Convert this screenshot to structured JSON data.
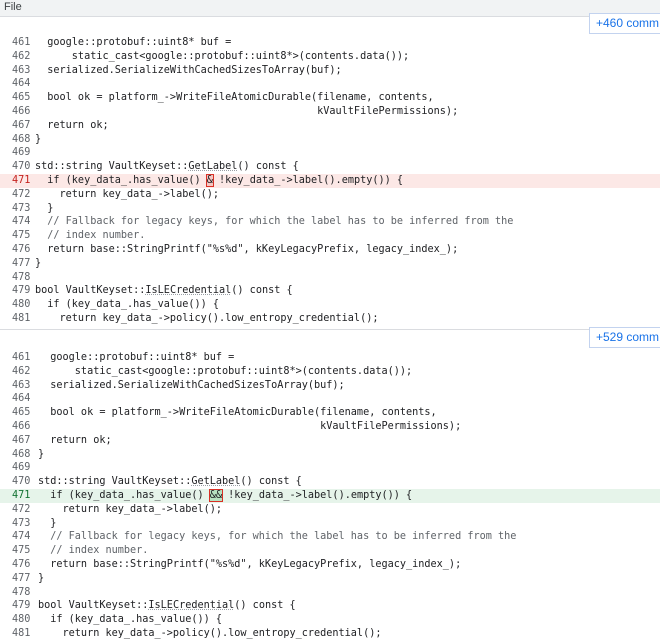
{
  "menu": {
    "file_label": "File"
  },
  "expanders": {
    "top": "+460 comm",
    "bottom": "+529 comm"
  },
  "colors": {
    "deleted_bg": "#fce8e6",
    "added_bg": "#e6f4ea",
    "highlight_border": "#d93025",
    "link": "#1a73e8"
  },
  "old_pane": {
    "lines": [
      {
        "num": "461",
        "text": "  google::protobuf::uint8* buf ="
      },
      {
        "num": "462",
        "text": "      static_cast<google::protobuf::uint8*>(contents.data());"
      },
      {
        "num": "463",
        "text": "  serialized.SerializeWithCachedSizesToArray(buf);"
      },
      {
        "num": "464",
        "text": ""
      },
      {
        "num": "465",
        "text": "  bool ok = platform_->WriteFileAtomicDurable(filename, contents,"
      },
      {
        "num": "466",
        "text": "                                              kVaultFilePermissions);"
      },
      {
        "num": "467",
        "text": "  return ok;"
      },
      {
        "num": "468",
        "text": "}"
      },
      {
        "num": "469",
        "text": ""
      },
      {
        "num": "470",
        "pre": "std::string VaultKeyset::",
        "fn": "GetLabel",
        "post": "() const {"
      },
      {
        "num": "471",
        "pre": "  if (key_data_.has_value() ",
        "mark": "&",
        "post": " !key_data_->label().empty()) {",
        "change": "del"
      },
      {
        "num": "472",
        "text": "    return key_data_->label();"
      },
      {
        "num": "473",
        "text": "  }"
      },
      {
        "num": "474",
        "text": "  // Fallback for legacy keys, for which the label has to be inferred from the",
        "comment": true
      },
      {
        "num": "475",
        "text": "  // index number.",
        "comment": true
      },
      {
        "num": "476",
        "text": "  return base::StringPrintf(\"%s%d\", kKeyLegacyPrefix, legacy_index_);"
      },
      {
        "num": "477",
        "text": "}"
      },
      {
        "num": "478",
        "text": ""
      },
      {
        "num": "479",
        "pre": "bool VaultKeyset::",
        "fn": "IsLECredential",
        "post": "() const {"
      },
      {
        "num": "480",
        "text": "  if (key_data_.has_value()) {"
      },
      {
        "num": "481",
        "text": "    return key_data_->policy().low_entropy_credential();"
      }
    ]
  },
  "new_pane": {
    "lines": [
      {
        "num": "461",
        "text": "  google::protobuf::uint8* buf ="
      },
      {
        "num": "462",
        "text": "      static_cast<google::protobuf::uint8*>(contents.data());"
      },
      {
        "num": "463",
        "text": "  serialized.SerializeWithCachedSizesToArray(buf);"
      },
      {
        "num": "464",
        "text": ""
      },
      {
        "num": "465",
        "text": "  bool ok = platform_->WriteFileAtomicDurable(filename, contents,"
      },
      {
        "num": "466",
        "text": "                                              kVaultFilePermissions);"
      },
      {
        "num": "467",
        "text": "  return ok;"
      },
      {
        "num": "468",
        "text": "}"
      },
      {
        "num": "469",
        "text": ""
      },
      {
        "num": "470",
        "pre": "std::string VaultKeyset::",
        "fn": "GetLabel",
        "post": "() const {"
      },
      {
        "num": "471",
        "pre": "  if (key_data_.has_value() ",
        "mark": "&&",
        "post": " !key_data_->label().empty()) {",
        "change": "add"
      },
      {
        "num": "472",
        "text": "    return key_data_->label();"
      },
      {
        "num": "473",
        "text": "  }"
      },
      {
        "num": "474",
        "text": "  // Fallback for legacy keys, for which the label has to be inferred from the",
        "comment": true
      },
      {
        "num": "475",
        "text": "  // index number.",
        "comment": true
      },
      {
        "num": "476",
        "text": "  return base::StringPrintf(\"%s%d\", kKeyLegacyPrefix, legacy_index_);"
      },
      {
        "num": "477",
        "text": "}"
      },
      {
        "num": "478",
        "text": ""
      },
      {
        "num": "479",
        "pre": "bool VaultKeyset::",
        "fn": "IsLECredential",
        "post": "() const {"
      },
      {
        "num": "480",
        "text": "  if (key_data_.has_value()) {"
      },
      {
        "num": "481",
        "text": "    return key_data_->policy().low_entropy_credential();"
      }
    ]
  }
}
